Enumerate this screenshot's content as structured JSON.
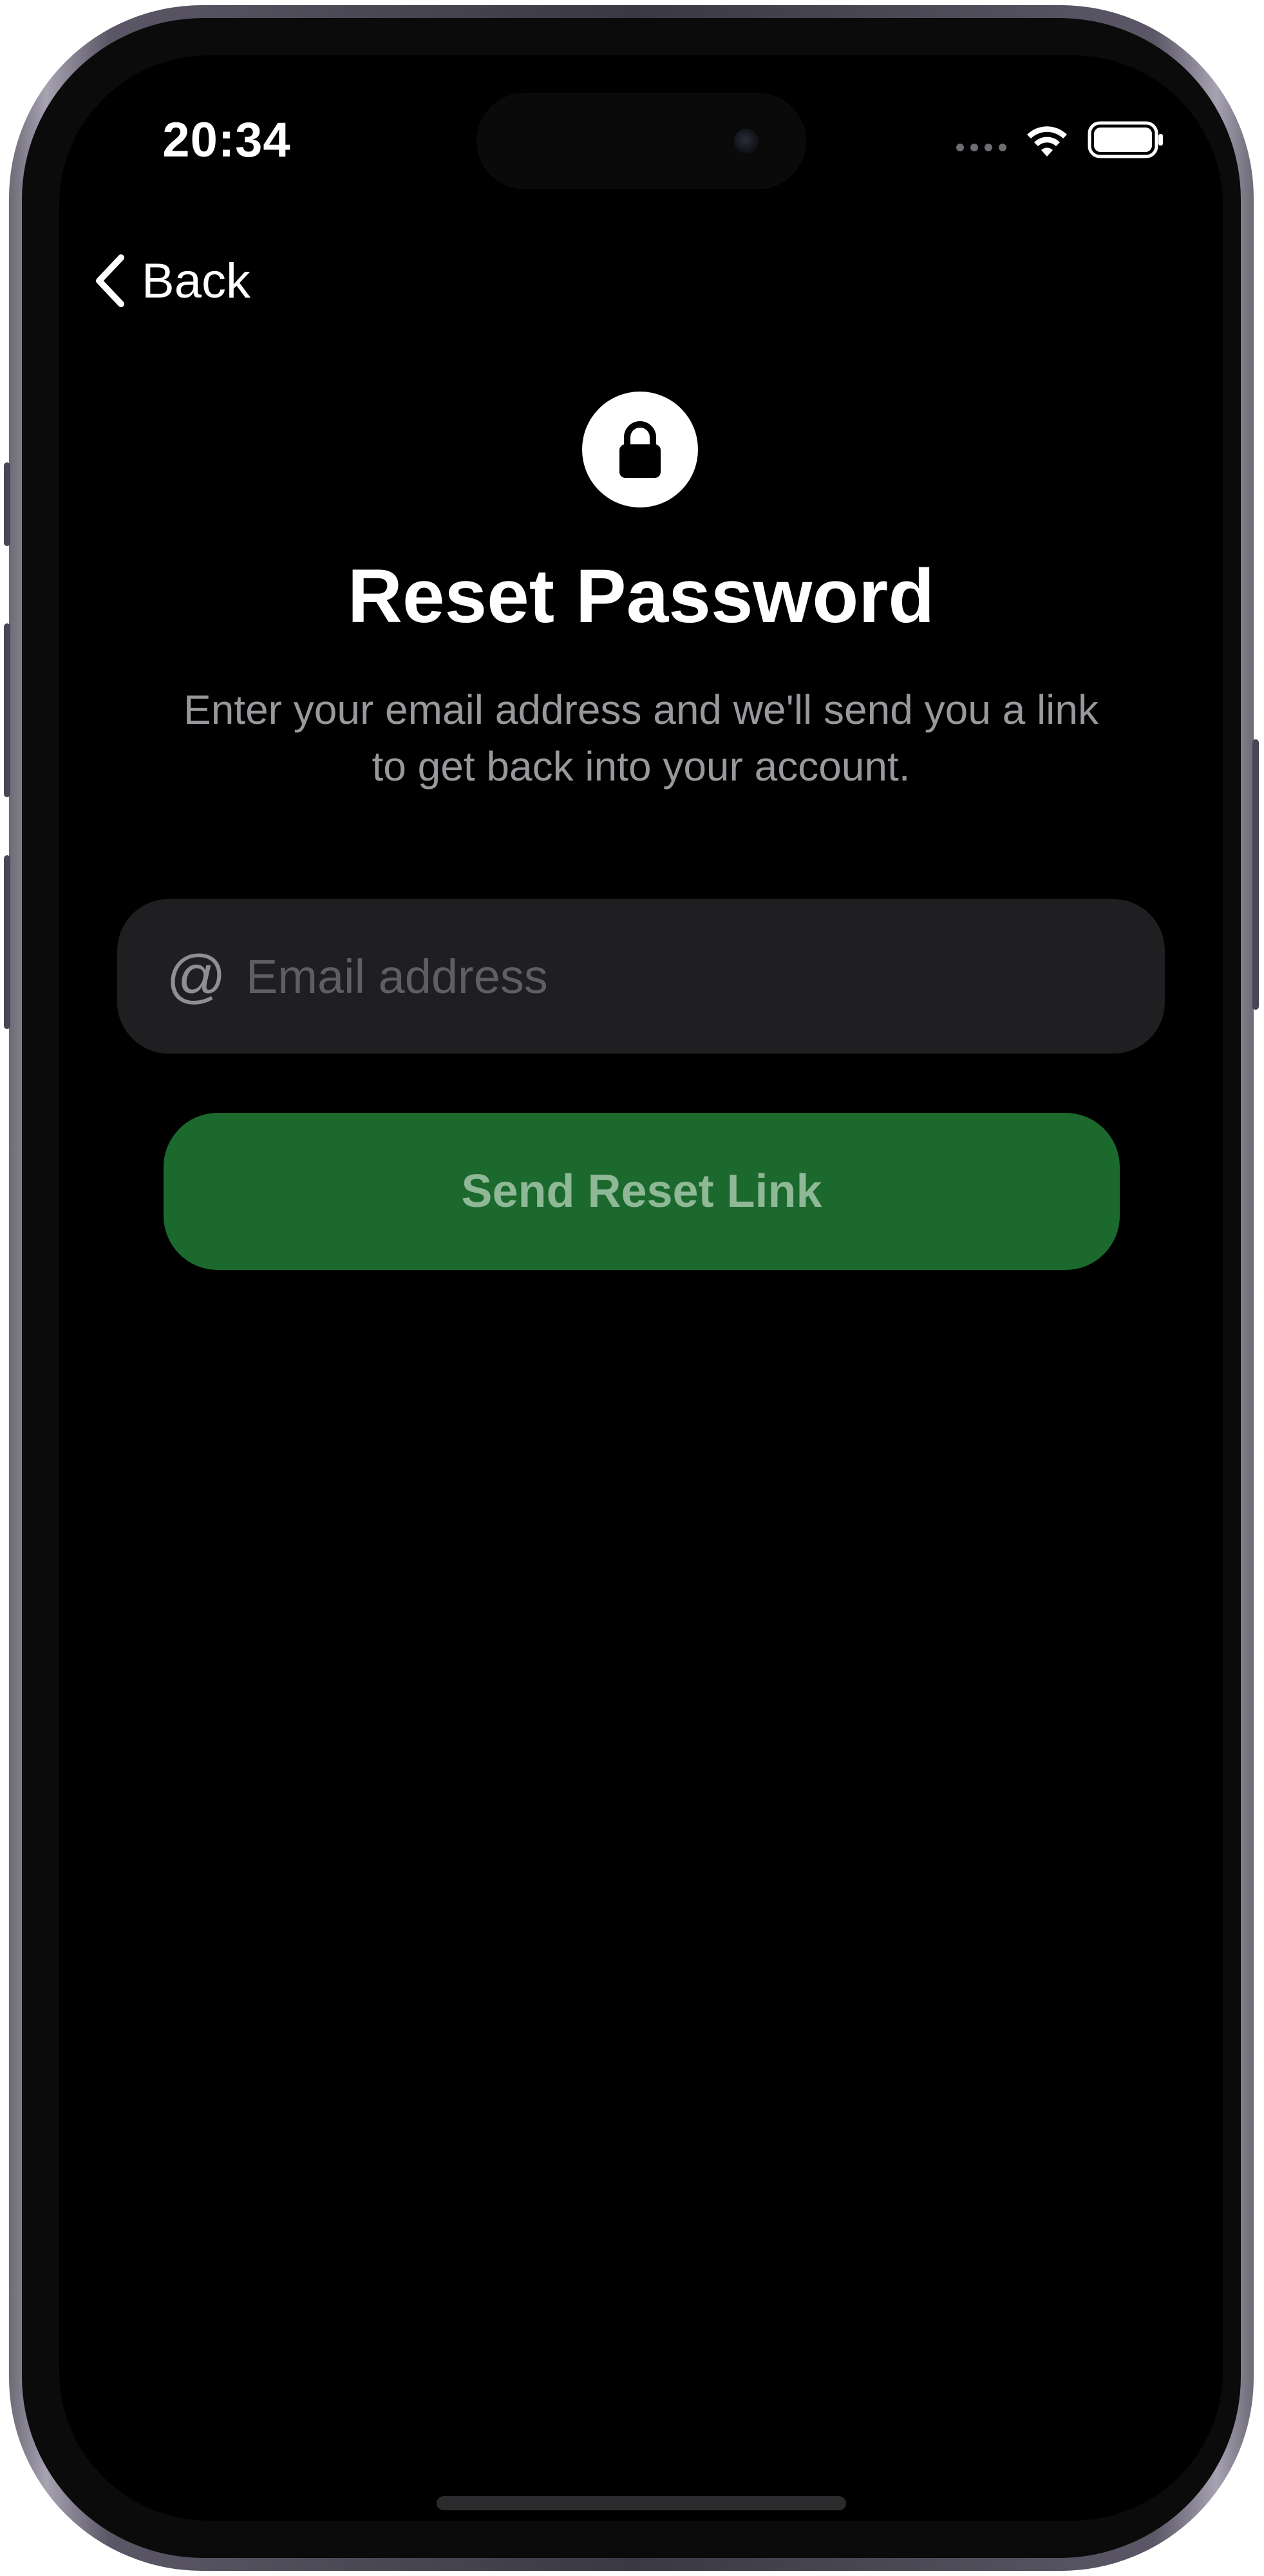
{
  "status_bar": {
    "time": "20:34",
    "icons": [
      "cellular-signal-icon",
      "wifi-icon",
      "battery-icon"
    ]
  },
  "nav": {
    "back_label": "Back",
    "back_icon": "chevron-left-icon"
  },
  "header": {
    "icon": "lock-icon",
    "title": "Reset Password",
    "subtitle": "Enter your email address and we'll send you a link to get back into your account."
  },
  "form": {
    "email": {
      "icon": "@",
      "value": "",
      "placeholder": "Email address"
    },
    "submit_label": "Send Reset Link"
  },
  "colors": {
    "background": "#000000",
    "field_background": "#1f1f21",
    "button_background": "#1b692d",
    "button_text": "#8fb896",
    "secondary_text": "#98989d"
  }
}
